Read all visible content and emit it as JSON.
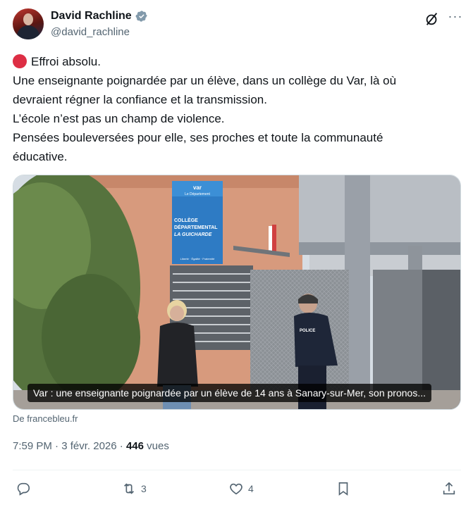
{
  "author": {
    "display_name": "David Rachline",
    "handle": "@david_rachline"
  },
  "tweet": {
    "lines": [
      "Effroi absolu.",
      "Une enseignante poignardée par un élève, dans un collège du Var, là où",
      "devraient régner la confiance et la transmission.",
      "L’école n’est pas un champ de violence.",
      "Pensées bouleversées pour elle, ses proches et toute la communauté",
      "éducative."
    ]
  },
  "media": {
    "sign_brand": "var",
    "sign_sub": "Le Département",
    "sign_line1": "COLLÈGE",
    "sign_line2": "DÉPARTEMENTAL",
    "sign_line3": "LA GUICHARDE",
    "sign_motto": "Liberté · Égalité · Fraternité",
    "police_badge": "POLICE",
    "caption": "Var : une enseignante poignardée par un élève de 14 ans à Sanary-sur-Mer, son pronos...",
    "source": "De francebleu.fr"
  },
  "meta": {
    "time": "7:59 PM",
    "separator": "·",
    "date": "3 févr. 2026",
    "views_count": "446",
    "views_label": "vues"
  },
  "actions": {
    "replies": "",
    "reposts": "3",
    "likes": "4"
  },
  "colors": {
    "accent": "#1d9bf0",
    "text": "#0f1419",
    "secondary": "#536471",
    "red_circle": "#dd2e44"
  },
  "icons": [
    "verified-badge-icon",
    "grok-icon",
    "more-icon",
    "red-circle-icon",
    "reply-icon",
    "repost-icon",
    "like-icon",
    "bookmark-icon",
    "share-icon"
  ]
}
